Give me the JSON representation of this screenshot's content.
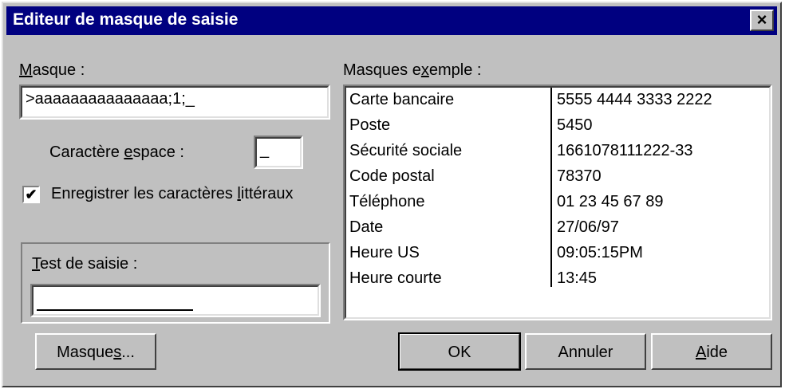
{
  "window": {
    "title": "Editeur de masque de saisie",
    "close_glyph": "×"
  },
  "mask": {
    "label_pre": "",
    "label_key": "M",
    "label_post": "asque :",
    "value": ">aaaaaaaaaaaaaaa;1;_"
  },
  "space_char": {
    "label_pre": "Caractère ",
    "label_key": "e",
    "label_post": "space :",
    "value": "_"
  },
  "save_literals": {
    "checked": true,
    "check_glyph": "✔",
    "label_pre": "Enregistrer les caractères ",
    "label_key": "l",
    "label_post": "ittéraux"
  },
  "test_input": {
    "label_pre": "",
    "label_key": "T",
    "label_post": "est de saisie :",
    "value": ""
  },
  "examples": {
    "label_pre": "Masques e",
    "label_key": "x",
    "label_post": "emple :",
    "rows": [
      {
        "name": "Carte bancaire",
        "mask": "5555 4444 3333 2222"
      },
      {
        "name": "Poste",
        "mask": "5450"
      },
      {
        "name": "Sécurité sociale",
        "mask": "1661078111222-33"
      },
      {
        "name": "Code postal",
        "mask": "78370"
      },
      {
        "name": "Téléphone",
        "mask": "01 23 45 67 89"
      },
      {
        "name": "Date",
        "mask": "27/06/97"
      },
      {
        "name": "Heure US",
        "mask": "09:05:15PM"
      },
      {
        "name": "Heure courte",
        "mask": "13:45"
      }
    ]
  },
  "buttons": {
    "masques_pre": "Masque",
    "masques_key": "s",
    "masques_post": "...",
    "ok": "OK",
    "annuler": "Annuler",
    "aide_pre": "",
    "aide_key": "A",
    "aide_post": "ide"
  }
}
